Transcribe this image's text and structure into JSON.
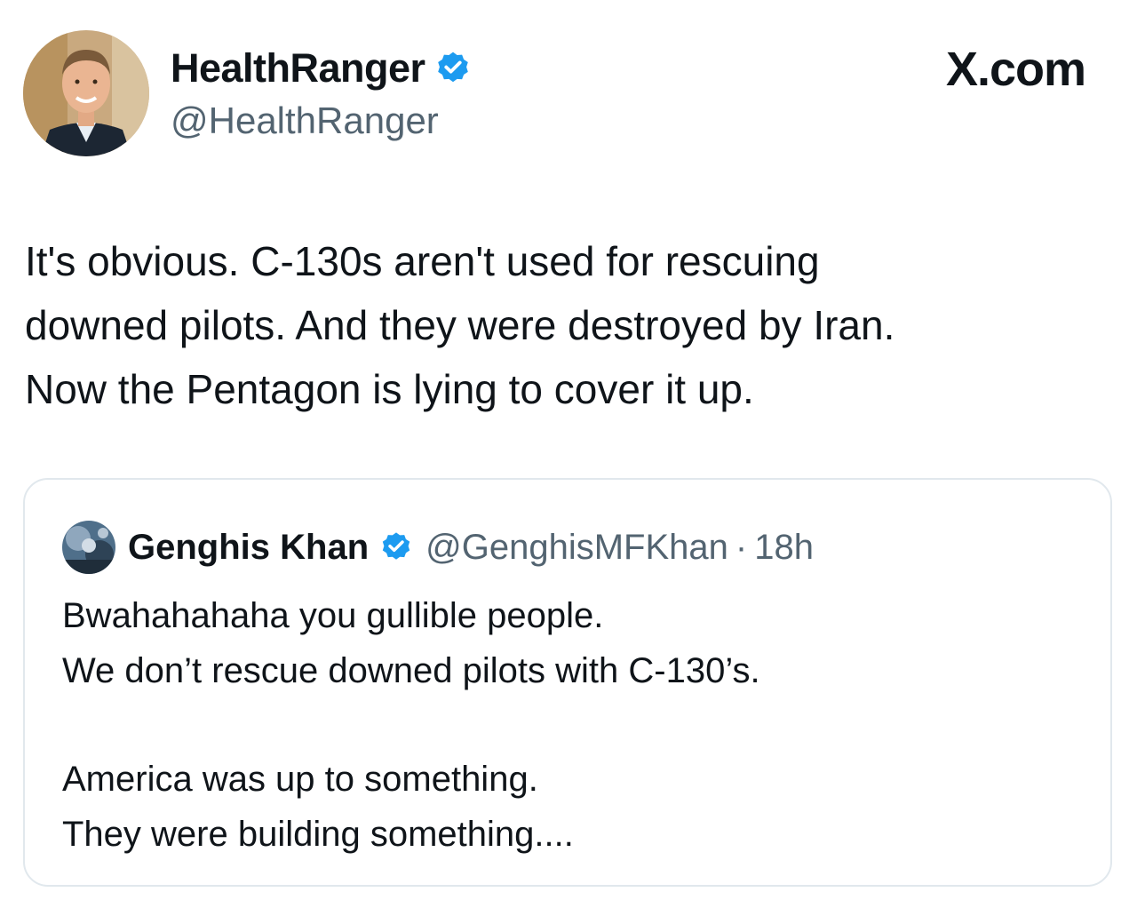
{
  "site": {
    "label": "X.com"
  },
  "author": {
    "name": "HealthRanger",
    "handle": "@HealthRanger",
    "verified": true,
    "verified_color": "#1d9bf0"
  },
  "tweet": {
    "lines": [
      "It's obvious. C-130s aren't used for rescuing",
      "downed pilots. And they were destroyed by Iran.",
      "Now the Pentagon is lying to cover it up."
    ]
  },
  "quote": {
    "name": "Genghis Khan",
    "handle": "@GenghisMFKhan",
    "separator": "·",
    "time": "18h",
    "verified": true,
    "paragraphs": [
      [
        "Bwahahahaha you gullible people.",
        "We don’t rescue downed pilots with C-130’s."
      ],
      [
        "America was up to something.",
        "They were building something...."
      ]
    ]
  },
  "icons": {
    "verified": "verified-badge-icon",
    "author_avatar": "profile-photo",
    "quote_avatar": "profile-photo"
  },
  "colors": {
    "text": "#0f1419",
    "secondary": "#536471",
    "border": "#e1e8ed",
    "accent": "#1d9bf0"
  }
}
